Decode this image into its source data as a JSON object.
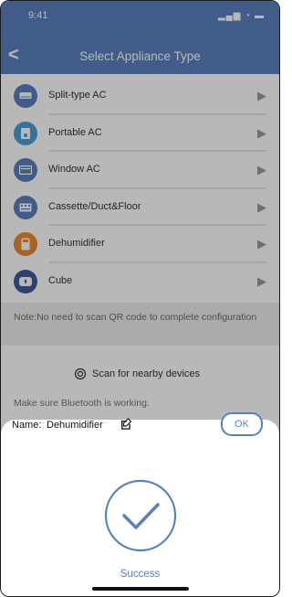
{
  "status": {
    "time": "9:41",
    "indicators": "▂▄▆ ◔ ▬"
  },
  "nav": {
    "back_glyph": "<",
    "title": "Select Appliance Type"
  },
  "appliances": [
    {
      "label": "Split-type AC",
      "icon": "split-ac-icon"
    },
    {
      "label": "Portable AC",
      "icon": "portable-ac-icon"
    },
    {
      "label": "Window AC",
      "icon": "window-ac-icon"
    },
    {
      "label": "Cassette/Duct&Floor",
      "icon": "cassette-icon"
    },
    {
      "label": "Dehumidifier",
      "icon": "dehumidifier-icon",
      "accent": "#e8892f"
    },
    {
      "label": "Cube",
      "icon": "cube-icon"
    }
  ],
  "note": "Note:No need to scan QR code to complete configuration",
  "scan": {
    "label": "Scan for nearby devices",
    "icon": "scan-icon"
  },
  "hint": "Make sure Bluetooth is working.",
  "sheet": {
    "name_label": "Name:",
    "name_value": "Dehumidifier",
    "ok_label": "OK",
    "success_label": "Success"
  },
  "colors": {
    "accent": "#5b80be",
    "orange": "#e8892f"
  }
}
